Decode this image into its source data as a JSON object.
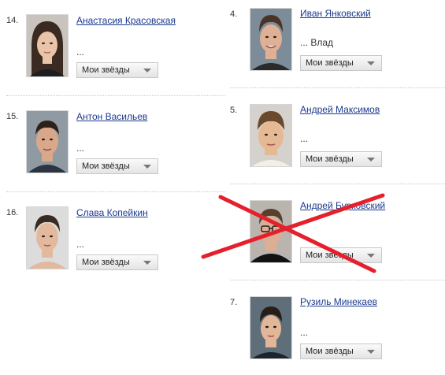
{
  "colors": {
    "link": "#1a3a8c",
    "strike": "#e5202d",
    "divider": "#c9c9c9"
  },
  "left_column": [
    {
      "rank": "14.",
      "name": "Анастасия Красовская",
      "note": "...",
      "select_value": "Мои звёзды",
      "hair": "#3b2a22",
      "skin": "#e8c4a8"
    },
    {
      "rank": "15.",
      "name": "Антон Васильев",
      "note": "...",
      "select_value": "Мои звёзды",
      "hair": "#2e2119",
      "skin": "#d9a88a"
    },
    {
      "rank": "16.",
      "name": "Слава Копейкин",
      "note": "...",
      "select_value": "Мои звёзды",
      "hair": "#3a2a1f",
      "skin": "#e3b99e"
    }
  ],
  "right_column": [
    {
      "rank": "4.",
      "name": "Иван Янковский",
      "note": "... Влад",
      "select_value": "Мои звёзды",
      "hair": "#4a3324",
      "skin": "#e0b096"
    },
    {
      "rank": "5.",
      "name": "Андрей Максимов",
      "note": "...",
      "select_value": "Мои звёзды",
      "hair": "#6b4a2c",
      "skin": "#e6b995"
    },
    {
      "rank": "",
      "name": "Андрей Бурковский",
      "note": "",
      "select_value": "Мои звёзды",
      "hair": "#5a3e2a",
      "skin": "#dcae94",
      "crossed_out": true
    },
    {
      "rank": "7.",
      "name": "Рузиль Минекаев",
      "note": "...",
      "select_value": "Мои звёзды",
      "hair": "#2a1d15",
      "skin": "#e2b699"
    }
  ],
  "icons": {
    "dropdown": "chevron-down-icon"
  }
}
